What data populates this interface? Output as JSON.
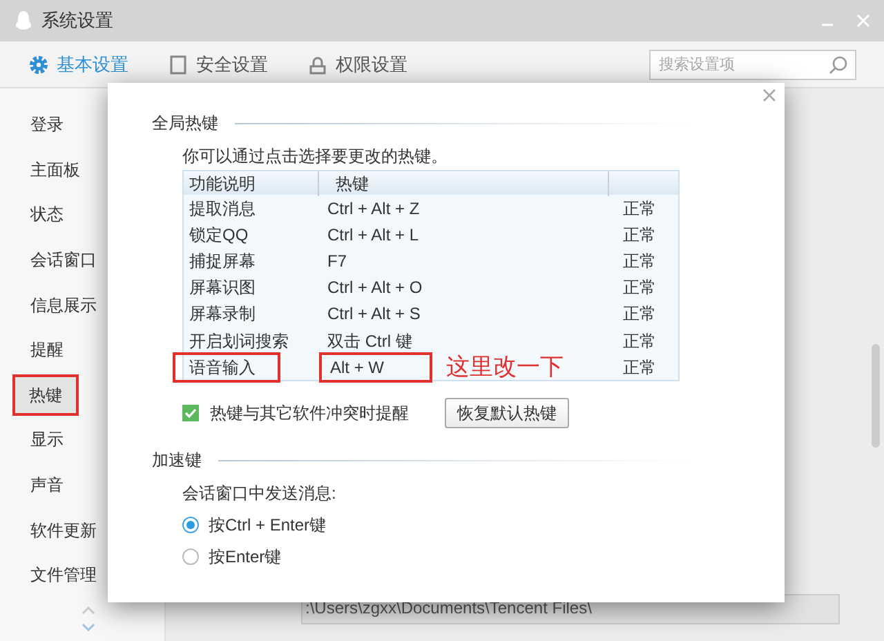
{
  "window": {
    "title": "系统设置"
  },
  "tabs": [
    {
      "label": "基本设置",
      "selected": true
    },
    {
      "label": "安全设置",
      "selected": false
    },
    {
      "label": "权限设置",
      "selected": false
    }
  ],
  "search": {
    "placeholder": "搜索设置项"
  },
  "sidebar": {
    "items": [
      {
        "label": "登录",
        "selected": false,
        "boxed": false
      },
      {
        "label": "主面板",
        "selected": false,
        "boxed": false
      },
      {
        "label": "状态",
        "selected": false,
        "boxed": false
      },
      {
        "label": "会话窗口",
        "selected": false,
        "boxed": false
      },
      {
        "label": "信息展示",
        "selected": false,
        "boxed": false
      },
      {
        "label": "提醒",
        "selected": false,
        "boxed": false
      },
      {
        "label": "热键",
        "selected": true,
        "boxed": true
      },
      {
        "label": "显示",
        "selected": false,
        "boxed": false
      },
      {
        "label": "声音",
        "selected": false,
        "boxed": false
      },
      {
        "label": "软件更新",
        "selected": false,
        "boxed": false
      },
      {
        "label": "文件管理",
        "selected": false,
        "boxed": false
      }
    ]
  },
  "background": {
    "path_field": ":\\Users\\zgxx\\Documents\\Tencent Files\\"
  },
  "dialog": {
    "global_section": {
      "title": "全局热键",
      "description": "你可以通过点击选择要更改的热键。",
      "table": {
        "columns": [
          "功能说明",
          "热键"
        ],
        "rows": [
          {
            "function": "提取消息",
            "hotkey": "Ctrl + Alt + Z",
            "status": "正常",
            "boxed": false
          },
          {
            "function": "锁定QQ",
            "hotkey": "Ctrl + Alt + L",
            "status": "正常",
            "boxed": false
          },
          {
            "function": "捕捉屏幕",
            "hotkey": "F7",
            "status": "正常",
            "boxed": false
          },
          {
            "function": "屏幕识图",
            "hotkey": "Ctrl + Alt + O",
            "status": "正常",
            "boxed": false
          },
          {
            "function": "屏幕录制",
            "hotkey": "Ctrl + Alt + S",
            "status": "正常",
            "boxed": false
          },
          {
            "function": "开启划词搜索",
            "hotkey": "双击 Ctrl 键",
            "status": "正常",
            "boxed": false
          },
          {
            "function": "语音输入",
            "hotkey": "Alt + W",
            "status": "正常",
            "boxed": true,
            "annotation": "这里改一下"
          }
        ]
      },
      "conflict_checkbox": {
        "label": "热键与其它软件冲突时提醒",
        "checked": true
      },
      "restore_button": "恢复默认热键"
    },
    "accel_section": {
      "title": "加速键",
      "label": "会话窗口中发送消息:",
      "options": [
        {
          "label": "按Ctrl + Enter键",
          "selected": true
        },
        {
          "label": "按Enter键",
          "selected": false
        }
      ]
    }
  }
}
